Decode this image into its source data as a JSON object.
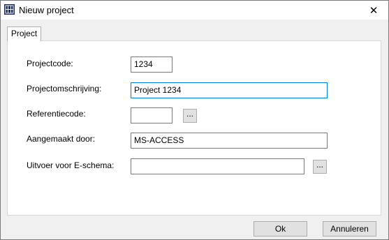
{
  "window": {
    "title": "Nieuw project",
    "close_glyph": "✕",
    "icon": "grid-app-icon"
  },
  "tabs": [
    {
      "label": "Project",
      "selected": true
    }
  ],
  "form": {
    "projectcode": {
      "label": "Projectcode:",
      "value": "1234"
    },
    "projectomschrijving": {
      "label": "Projectomschrijving:",
      "value": "Project 1234"
    },
    "referentiecode": {
      "label": "Referentiecode:",
      "value": "",
      "browse_label": "..."
    },
    "aangemaakt_door": {
      "label": "Aangemaakt door:",
      "value": "MS-ACCESS"
    },
    "uitvoer_e_schema": {
      "label": "Uitvoer voor E-schema:",
      "value": "",
      "browse_label": "..."
    }
  },
  "buttons": {
    "ok": "Ok",
    "cancel": "Annuleren"
  },
  "colors": {
    "focus_border": "#0078d7",
    "app_icon": "#1f2b57"
  }
}
